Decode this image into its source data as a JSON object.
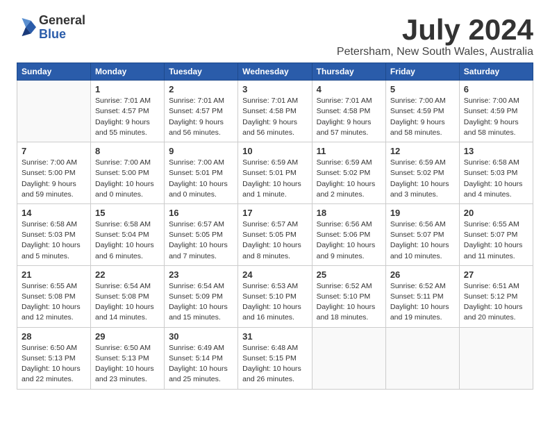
{
  "logo": {
    "general": "General",
    "blue": "Blue"
  },
  "title": {
    "month": "July 2024",
    "location": "Petersham, New South Wales, Australia"
  },
  "weekdays": [
    "Sunday",
    "Monday",
    "Tuesday",
    "Wednesday",
    "Thursday",
    "Friday",
    "Saturday"
  ],
  "weeks": [
    [
      {
        "day": "",
        "info": ""
      },
      {
        "day": "1",
        "info": "Sunrise: 7:01 AM\nSunset: 4:57 PM\nDaylight: 9 hours\nand 55 minutes."
      },
      {
        "day": "2",
        "info": "Sunrise: 7:01 AM\nSunset: 4:57 PM\nDaylight: 9 hours\nand 56 minutes."
      },
      {
        "day": "3",
        "info": "Sunrise: 7:01 AM\nSunset: 4:58 PM\nDaylight: 9 hours\nand 56 minutes."
      },
      {
        "day": "4",
        "info": "Sunrise: 7:01 AM\nSunset: 4:58 PM\nDaylight: 9 hours\nand 57 minutes."
      },
      {
        "day": "5",
        "info": "Sunrise: 7:00 AM\nSunset: 4:59 PM\nDaylight: 9 hours\nand 58 minutes."
      },
      {
        "day": "6",
        "info": "Sunrise: 7:00 AM\nSunset: 4:59 PM\nDaylight: 9 hours\nand 58 minutes."
      }
    ],
    [
      {
        "day": "7",
        "info": "Sunrise: 7:00 AM\nSunset: 5:00 PM\nDaylight: 9 hours\nand 59 minutes."
      },
      {
        "day": "8",
        "info": "Sunrise: 7:00 AM\nSunset: 5:00 PM\nDaylight: 10 hours\nand 0 minutes."
      },
      {
        "day": "9",
        "info": "Sunrise: 7:00 AM\nSunset: 5:01 PM\nDaylight: 10 hours\nand 0 minutes."
      },
      {
        "day": "10",
        "info": "Sunrise: 6:59 AM\nSunset: 5:01 PM\nDaylight: 10 hours\nand 1 minute."
      },
      {
        "day": "11",
        "info": "Sunrise: 6:59 AM\nSunset: 5:02 PM\nDaylight: 10 hours\nand 2 minutes."
      },
      {
        "day": "12",
        "info": "Sunrise: 6:59 AM\nSunset: 5:02 PM\nDaylight: 10 hours\nand 3 minutes."
      },
      {
        "day": "13",
        "info": "Sunrise: 6:58 AM\nSunset: 5:03 PM\nDaylight: 10 hours\nand 4 minutes."
      }
    ],
    [
      {
        "day": "14",
        "info": "Sunrise: 6:58 AM\nSunset: 5:03 PM\nDaylight: 10 hours\nand 5 minutes."
      },
      {
        "day": "15",
        "info": "Sunrise: 6:58 AM\nSunset: 5:04 PM\nDaylight: 10 hours\nand 6 minutes."
      },
      {
        "day": "16",
        "info": "Sunrise: 6:57 AM\nSunset: 5:05 PM\nDaylight: 10 hours\nand 7 minutes."
      },
      {
        "day": "17",
        "info": "Sunrise: 6:57 AM\nSunset: 5:05 PM\nDaylight: 10 hours\nand 8 minutes."
      },
      {
        "day": "18",
        "info": "Sunrise: 6:56 AM\nSunset: 5:06 PM\nDaylight: 10 hours\nand 9 minutes."
      },
      {
        "day": "19",
        "info": "Sunrise: 6:56 AM\nSunset: 5:07 PM\nDaylight: 10 hours\nand 10 minutes."
      },
      {
        "day": "20",
        "info": "Sunrise: 6:55 AM\nSunset: 5:07 PM\nDaylight: 10 hours\nand 11 minutes."
      }
    ],
    [
      {
        "day": "21",
        "info": "Sunrise: 6:55 AM\nSunset: 5:08 PM\nDaylight: 10 hours\nand 12 minutes."
      },
      {
        "day": "22",
        "info": "Sunrise: 6:54 AM\nSunset: 5:08 PM\nDaylight: 10 hours\nand 14 minutes."
      },
      {
        "day": "23",
        "info": "Sunrise: 6:54 AM\nSunset: 5:09 PM\nDaylight: 10 hours\nand 15 minutes."
      },
      {
        "day": "24",
        "info": "Sunrise: 6:53 AM\nSunset: 5:10 PM\nDaylight: 10 hours\nand 16 minutes."
      },
      {
        "day": "25",
        "info": "Sunrise: 6:52 AM\nSunset: 5:10 PM\nDaylight: 10 hours\nand 18 minutes."
      },
      {
        "day": "26",
        "info": "Sunrise: 6:52 AM\nSunset: 5:11 PM\nDaylight: 10 hours\nand 19 minutes."
      },
      {
        "day": "27",
        "info": "Sunrise: 6:51 AM\nSunset: 5:12 PM\nDaylight: 10 hours\nand 20 minutes."
      }
    ],
    [
      {
        "day": "28",
        "info": "Sunrise: 6:50 AM\nSunset: 5:13 PM\nDaylight: 10 hours\nand 22 minutes."
      },
      {
        "day": "29",
        "info": "Sunrise: 6:50 AM\nSunset: 5:13 PM\nDaylight: 10 hours\nand 23 minutes."
      },
      {
        "day": "30",
        "info": "Sunrise: 6:49 AM\nSunset: 5:14 PM\nDaylight: 10 hours\nand 25 minutes."
      },
      {
        "day": "31",
        "info": "Sunrise: 6:48 AM\nSunset: 5:15 PM\nDaylight: 10 hours\nand 26 minutes."
      },
      {
        "day": "",
        "info": ""
      },
      {
        "day": "",
        "info": ""
      },
      {
        "day": "",
        "info": ""
      }
    ]
  ]
}
